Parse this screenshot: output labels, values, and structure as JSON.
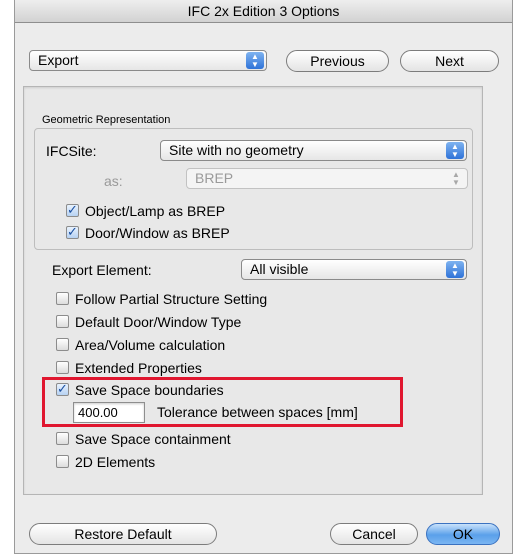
{
  "window": {
    "title": "IFC 2x Edition 3 Options"
  },
  "top": {
    "section_value": "Export",
    "previous_label": "Previous",
    "next_label": "Next"
  },
  "geometric": {
    "group_label": "Geometric Representation",
    "ifcsite_label": "IFCSite:",
    "ifcsite_value": "Site with no geometry",
    "as_label": "as:",
    "as_value": "BREP",
    "object_lamp_label": "Object/Lamp as BREP",
    "door_window_label": "Door/Window as BREP"
  },
  "export": {
    "element_label": "Export Element:",
    "element_value": "All visible"
  },
  "options": {
    "follow_partial": "Follow Partial Structure Setting",
    "default_door": "Default Door/Window Type",
    "area_volume": "Area/Volume calculation",
    "extended": "Extended Properties",
    "save_space_boundaries": "Save Space boundaries",
    "tolerance_value": "400.00",
    "tolerance_label": "Tolerance between spaces [mm]",
    "save_space_containment": "Save Space containment",
    "elements_2d": "2D Elements"
  },
  "checked": {
    "object_lamp": true,
    "door_window": true,
    "follow_partial": false,
    "default_door": false,
    "area_volume": false,
    "extended": false,
    "save_space_boundaries": true,
    "save_space_containment": false,
    "elements_2d": false
  },
  "bottom": {
    "restore_label": "Restore Default",
    "cancel_label": "Cancel",
    "ok_label": "OK"
  },
  "colors": {
    "highlight": "#e0162f",
    "accent": "#5aa0ea"
  },
  "icons": {
    "popup_arrows": "updown-arrows-icon",
    "checkmark": "checkmark-icon"
  }
}
